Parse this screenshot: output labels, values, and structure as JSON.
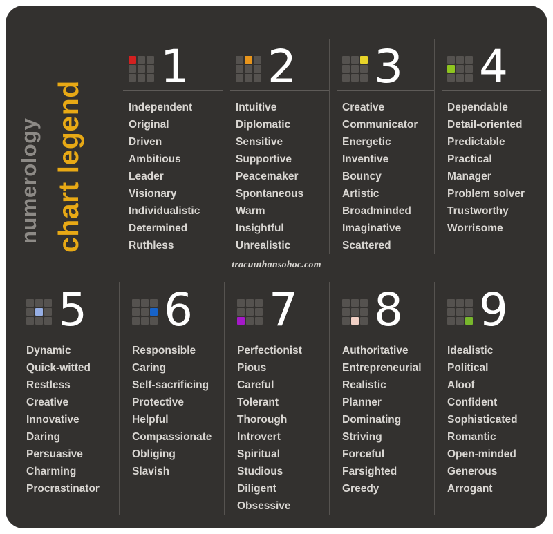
{
  "title": {
    "line1": "numerology",
    "line2": "chart legend",
    "line1_color": "#8d8a86",
    "line2_color": "#e8a915"
  },
  "watermark": "tracuuthansohoc.com",
  "card": {
    "background": "#33312f",
    "icon_cell_color": "#55524f",
    "numeral_color": "#ffffff",
    "trait_color": "#d9d6d2"
  },
  "panels": [
    {
      "number": "1",
      "icon_name": "grid-icon-1",
      "highlight_index": 0,
      "highlight_color": "#d32020",
      "traits": [
        "Independent",
        "Original",
        "Driven",
        "Ambitious",
        "Leader",
        "Visionary",
        "Individualistic",
        "Determined",
        "Ruthless"
      ]
    },
    {
      "number": "2",
      "icon_name": "grid-icon-2",
      "highlight_index": 1,
      "highlight_color": "#e8951c",
      "traits": [
        "Intuitive",
        "Diplomatic",
        "Sensitive",
        "Supportive",
        "Peacemaker",
        "Spontaneous",
        "Warm",
        "Insightful",
        "Unrealistic"
      ]
    },
    {
      "number": "3",
      "icon_name": "grid-icon-3",
      "highlight_index": 2,
      "highlight_color": "#e8d429",
      "traits": [
        "Creative",
        "Communicator",
        "Energetic",
        "Inventive",
        "Bouncy",
        "Artistic",
        "Broadminded",
        "Imaginative",
        "Scattered"
      ]
    },
    {
      "number": "4",
      "icon_name": "grid-icon-4",
      "highlight_index": 3,
      "highlight_color": "#8ec51f",
      "traits": [
        "Dependable",
        "Detail-oriented",
        "Predictable",
        "Practical",
        "Manager",
        "Problem solver",
        "Trustworthy",
        "Worrisome"
      ]
    },
    {
      "number": "5",
      "icon_name": "grid-icon-5",
      "highlight_index": 4,
      "highlight_color": "#96aee4",
      "traits": [
        "Dynamic",
        "Quick-witted",
        "Restless",
        "Creative",
        "Innovative",
        "Daring",
        "Persuasive",
        "Charming",
        "Procrastinator"
      ]
    },
    {
      "number": "6",
      "icon_name": "grid-icon-6",
      "highlight_index": 5,
      "highlight_color": "#1763c9",
      "traits": [
        "Responsible",
        "Caring",
        "Self-sacrificing",
        "Protective",
        "Helpful",
        "Compassionate",
        "Obliging",
        "Slavish"
      ]
    },
    {
      "number": "7",
      "icon_name": "grid-icon-7",
      "highlight_index": 6,
      "highlight_color": "#a519c9",
      "traits": [
        "Perfectionist",
        "Pious",
        "Careful",
        "Tolerant",
        "Thorough",
        "Introvert",
        "Spiritual",
        "Studious",
        "Diligent",
        "Obsessive"
      ]
    },
    {
      "number": "8",
      "icon_name": "grid-icon-8",
      "highlight_index": 7,
      "highlight_color": "#f0cfc4",
      "traits": [
        "Authoritative",
        "Entrepreneurial",
        "Realistic",
        "Planner",
        "Dominating",
        "Striving",
        "Forceful",
        "Farsighted",
        "Greedy"
      ]
    },
    {
      "number": "9",
      "icon_name": "grid-icon-9",
      "highlight_index": 8,
      "highlight_color": "#78b72c",
      "traits": [
        "Idealistic",
        "Political",
        "Aloof",
        "Confident",
        "Sophisticated",
        "Romantic",
        "Open-minded",
        "Generous",
        "Arrogant"
      ]
    }
  ]
}
